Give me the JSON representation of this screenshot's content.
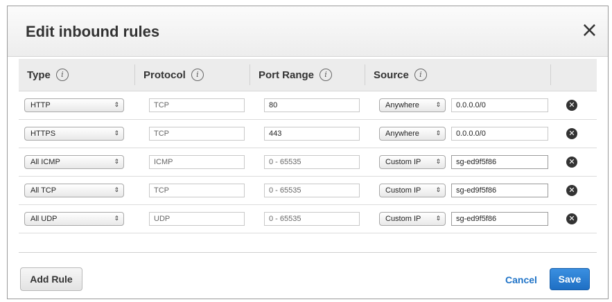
{
  "dialog": {
    "title": "Edit inbound rules",
    "close_label": "×"
  },
  "columns": [
    {
      "label": "Type",
      "info": "i"
    },
    {
      "label": "Protocol",
      "info": "i"
    },
    {
      "label": "Port Range",
      "info": "i"
    },
    {
      "label": "Source",
      "info": "i"
    }
  ],
  "rules": [
    {
      "type": "HTTP",
      "protocol": "TCP",
      "port_range": "80",
      "source_type": "Anywhere",
      "source": "0.0.0.0/0"
    },
    {
      "type": "HTTPS",
      "protocol": "TCP",
      "port_range": "443",
      "source_type": "Anywhere",
      "source": "0.0.0.0/0"
    },
    {
      "type": "All ICMP",
      "protocol": "ICMP",
      "port_range": "0 - 65535",
      "source_type": "Custom IP",
      "source": "sg-ed9f5f86"
    },
    {
      "type": "All TCP",
      "protocol": "TCP",
      "port_range": "0 - 65535",
      "source_type": "Custom IP",
      "source": "sg-ed9f5f86"
    },
    {
      "type": "All UDP",
      "protocol": "UDP",
      "port_range": "0 - 65535",
      "source_type": "Custom IP",
      "source": "sg-ed9f5f86"
    }
  ],
  "footer": {
    "add_rule": "Add Rule",
    "cancel": "Cancel",
    "save": "Save"
  },
  "icons": {
    "select_arrows": "⇕",
    "delete": "✕"
  },
  "colors": {
    "accent": "#1f73c7",
    "save_bg": "#2a7fd4"
  }
}
